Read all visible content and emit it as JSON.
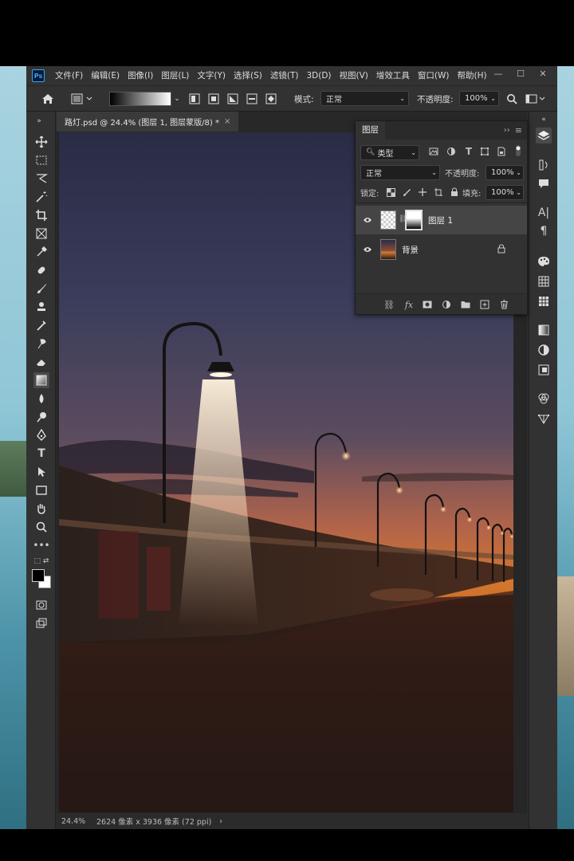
{
  "app": {
    "logo": "Ps"
  },
  "menu": [
    "文件(F)",
    "编辑(E)",
    "图像(I)",
    "图层(L)",
    "文字(Y)",
    "选择(S)",
    "滤镜(T)",
    "3D(D)",
    "视图(V)",
    "增效工具",
    "窗口(W)",
    "帮助(H)"
  ],
  "window_controls": {
    "minimize": "—",
    "maximize": "☐",
    "close": "✕"
  },
  "options": {
    "mode_label": "模式:",
    "mode_value": "正常",
    "opacity_label": "不透明度:",
    "opacity_value": "100%"
  },
  "document": {
    "tab_title": "路灯.psd @ 24.4% (图层 1, 图层蒙版/8) *",
    "tab_close": "×",
    "zoom": "24.4%",
    "dimensions": "2624 像素 x 3936 像素 (72 ppi)",
    "status_arrow": "›"
  },
  "layers_panel": {
    "title": "图层",
    "filter_label": "类型",
    "blend_mode": "正常",
    "opacity_label": "不透明度:",
    "opacity_value": "100%",
    "lock_label": "锁定:",
    "fill_label": "填充:",
    "fill_value": "100%",
    "layers": [
      {
        "name": "图层 1",
        "selected": true,
        "locked": false
      },
      {
        "name": "背景",
        "selected": false,
        "locked": true
      }
    ]
  },
  "colors": {
    "accent": "#31a8ff",
    "panel_bg": "#323232",
    "app_bg": "#2b2b2b"
  }
}
